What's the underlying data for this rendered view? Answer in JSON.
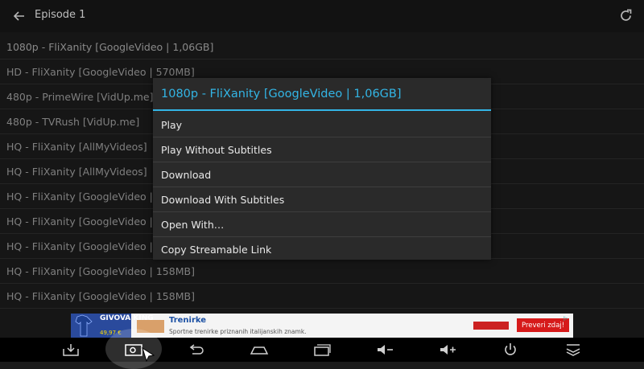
{
  "app": {
    "title": "Episode 1"
  },
  "list": {
    "rows": [
      "1080p - FliXanity [GoogleVideo | 1,06GB]",
      "HD - FliXanity [GoogleVideo | 570MB]",
      "480p - PrimeWire [VidUp.me]",
      "480p - TVRush [VidUp.me]",
      "HQ - FliXanity [AllMyVideos]",
      "HQ - FliXanity [AllMyVideos]",
      "HQ - FliXanity [GoogleVideo | 10",
      "HQ - FliXanity [GoogleVideo | 15",
      "HQ - FliXanity [GoogleVideo | 15",
      "HQ - FliXanity [GoogleVideo | 158MB]",
      "HQ - FliXanity [GoogleVideo | 158MB]"
    ]
  },
  "dialog": {
    "title": "1080p - FliXanity [GoogleVideo | 1,06GB]",
    "items": [
      "Play",
      "Play Without Subtitles",
      "Download",
      "Download With Subtitles",
      "Open With…",
      "Copy Streamable Link"
    ]
  },
  "ad": {
    "brand": "GIVOVA KING",
    "price": "49,97 €",
    "headline": "Trenirke",
    "subtitle": "Sportne trenirke priznanih italijanskih znamk.",
    "cta": "Preveri zdaj!"
  },
  "colors": {
    "accent": "#33b5e5",
    "background": "#1b1b1b",
    "ad_cta": "#d61a1a"
  },
  "navbar": {
    "icons": [
      "download-icon",
      "screenshot-icon",
      "back-icon",
      "home-icon",
      "recent-apps-icon",
      "volume-down-icon",
      "volume-up-icon",
      "power-icon",
      "collapse-icon"
    ]
  }
}
